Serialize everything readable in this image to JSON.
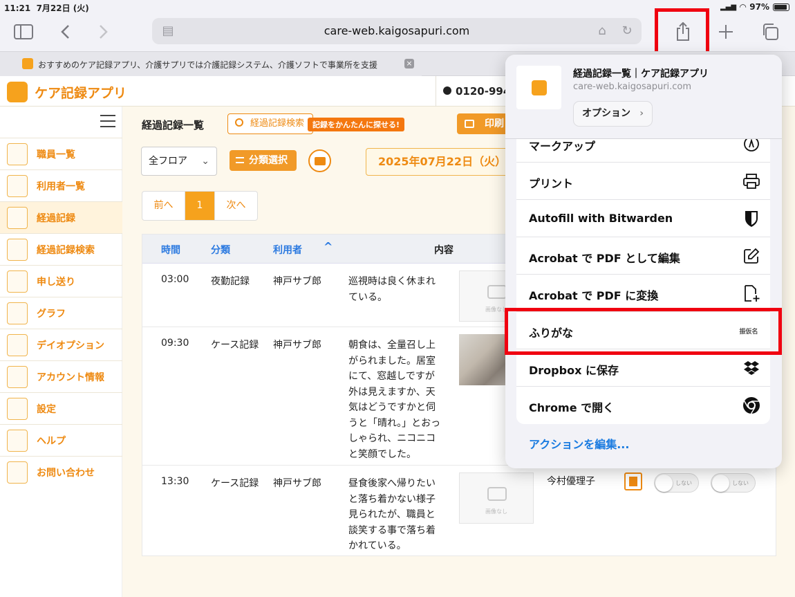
{
  "status": {
    "time": "11:21",
    "date": "7月22日 (火)",
    "battery": "97%"
  },
  "browser": {
    "url": "care-web.kaigosapuri.com",
    "tab_title": "おすすめのケア記録アプリ、介護サプリでは介護記録システム、介護ソフトで事業所を支援",
    "tab_close": "×"
  },
  "site": {
    "logo_text": "ケア記録アプリ",
    "phone": "0120-994-"
  },
  "sidebar": {
    "items": [
      {
        "label": "職員一覧"
      },
      {
        "label": "利用者一覧"
      },
      {
        "label": "経過記録"
      },
      {
        "label": "経過記録検索"
      },
      {
        "label": "申し送り"
      },
      {
        "label": "グラフ"
      },
      {
        "label": "デイオプション"
      },
      {
        "label": "アカウント情報"
      },
      {
        "label": "設定"
      },
      {
        "label": "ヘルプ"
      },
      {
        "label": "お問い合わせ"
      }
    ]
  },
  "main": {
    "title": "経過記録一覧",
    "search_label": "経過記録検索",
    "search_hint": "記録をかんたんに探せる!",
    "print_label": "印刷",
    "floor_value": "全フロア",
    "category_label": "分類選択",
    "date_value": "2025年07月22日（火）",
    "pager": {
      "prev": "前へ",
      "current": "1",
      "next": "次へ"
    },
    "columns": {
      "time": "時間",
      "category": "分類",
      "user": "利用者",
      "sort_arrow": "^",
      "content": "内容"
    },
    "no_image": "画像なし",
    "rows": [
      {
        "time": "03:00",
        "category": "夜勤記録",
        "user": "神戸サブ郎",
        "text": "巡視時は良く休まれている。"
      },
      {
        "time": "09:30",
        "category": "ケース記録",
        "user": "神戸サブ郎",
        "text": "朝食は、全量召し上がられました。居室にて、窓越しですが外は見えますか、天気はどうですかと伺うと「晴れ。」とおっしゃられ、ニコニコと笑顔でした。"
      },
      {
        "time": "13:30",
        "category": "ケース記録",
        "user": "神戸サブ郎",
        "text": "昼食後家へ帰りたいと落ち着かない様子見られたが、職員と談笑する事で落ち着かれている。",
        "staff": "今村優理子",
        "toggle1": "しない",
        "toggle2": "しない"
      }
    ]
  },
  "share_sheet": {
    "title": "経過記録一覧｜ケア記録アプリ",
    "url": "care-web.kaigosapuri.com",
    "options_label": "オプション",
    "actions": [
      {
        "label": "マークアップ",
        "icon": "markup-icon"
      },
      {
        "label": "プリント",
        "icon": "printer-icon"
      },
      {
        "label": "Autofill with Bitwarden",
        "icon": "shield-icon"
      },
      {
        "label": "Acrobat で PDF として編集",
        "icon": "edit-icon"
      },
      {
        "label": "Acrobat で PDF に変換",
        "icon": "pdf-icon"
      },
      {
        "label": "ふりがな",
        "icon": "furigana-icon"
      },
      {
        "label": "Dropbox に保存",
        "icon": "dropbox-icon"
      },
      {
        "label": "Chrome で開く",
        "icon": "chrome-icon"
      }
    ],
    "furigana_icon_text": "振仮名",
    "edit_actions": "アクションを編集..."
  },
  "colors": {
    "accent": "#ee8a12",
    "highlight": "#f00010",
    "link": "#1a7be0"
  }
}
